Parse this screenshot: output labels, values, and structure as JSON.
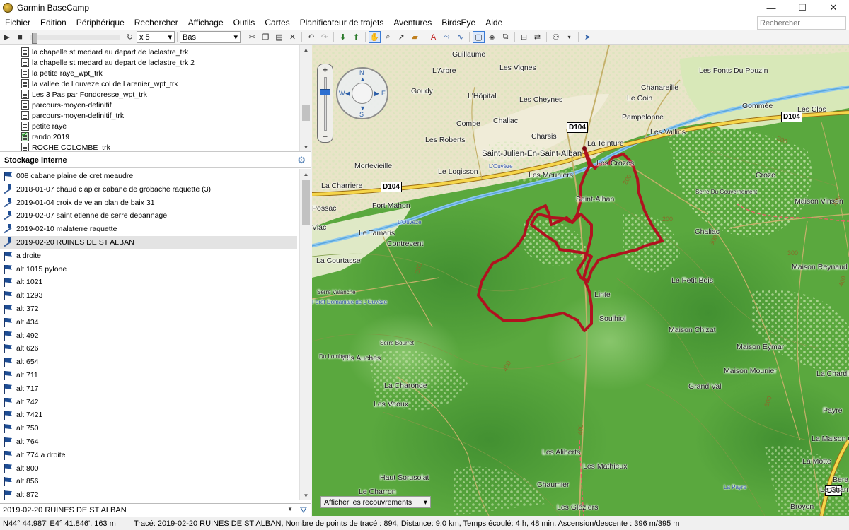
{
  "window": {
    "title": "Garmin BaseCamp",
    "controls": [
      "—",
      "☐",
      "✕"
    ]
  },
  "menu": {
    "items": [
      "Fichier",
      "Edition",
      "Périphérique",
      "Rechercher",
      "Affichage",
      "Outils",
      "Cartes",
      "Planificateur de trajets",
      "Aventures",
      "BirdsEye",
      "Aide"
    ],
    "search_placeholder": "Rechercher"
  },
  "toolbar": {
    "speed": "x 5",
    "speed_arrow": "▾",
    "view": "Bas",
    "view_arrow": "▾"
  },
  "tree": {
    "items": [
      {
        "label": "la chapelle st medard  au depart de laclastre_trk",
        "checked": false
      },
      {
        "label": "la chapelle st medard  au depart de laclastre_trk 2",
        "checked": false
      },
      {
        "label": "la petite raye_wpt_trk",
        "checked": false
      },
      {
        "label": "la vallee de l ouveze  col de l arenier_wpt_trk",
        "checked": false
      },
      {
        "label": "Les 3 Pas par Fondoresse_wpt_trk",
        "checked": false
      },
      {
        "label": "parcours-moyen-definitif",
        "checked": false
      },
      {
        "label": "parcours-moyen-definitif_trk",
        "checked": false
      },
      {
        "label": "petite raye",
        "checked": false
      },
      {
        "label": "rando 2019",
        "checked": true
      },
      {
        "label": "ROCHE COLOMBE_trk",
        "checked": false
      }
    ]
  },
  "storage": {
    "title": "Stockage interne",
    "items": [
      {
        "label": "008  cabane plaine de cret meaudre",
        "icon": "flag-icon"
      },
      {
        "label": "2018-01-07   chaud clapier cabane de grobache   raquette (3)",
        "icon": "track-icon"
      },
      {
        "label": "2019-01-04  croix de velan plan de baix 31",
        "icon": "track-icon"
      },
      {
        "label": "2019-02-07 saint etienne de serre    depannage",
        "icon": "track-icon"
      },
      {
        "label": "2019-02-10  malaterre  raquette",
        "icon": "track-icon"
      },
      {
        "label": "2019-02-20  RUINES DE ST ALBAN",
        "icon": "track-icon",
        "selected": true
      },
      {
        "label": "a droite",
        "icon": "flag-icon"
      },
      {
        "label": "alt 1015 pylone",
        "icon": "flag-icon"
      },
      {
        "label": "alt 1021",
        "icon": "flag-icon"
      },
      {
        "label": "alt 1293",
        "icon": "flag-icon"
      },
      {
        "label": "alt 372",
        "icon": "flag-icon"
      },
      {
        "label": "alt 434",
        "icon": "flag-icon"
      },
      {
        "label": "alt 492",
        "icon": "flag-icon"
      },
      {
        "label": "alt 626",
        "icon": "flag-icon"
      },
      {
        "label": "alt 654",
        "icon": "flag-icon"
      },
      {
        "label": "alt 711",
        "icon": "flag-icon"
      },
      {
        "label": "alt 717",
        "icon": "flag-icon"
      },
      {
        "label": "alt 742",
        "icon": "flag-icon"
      },
      {
        "label": "alt 7421",
        "icon": "flag-icon"
      },
      {
        "label": "alt 750",
        "icon": "flag-icon"
      },
      {
        "label": "alt 764",
        "icon": "flag-icon"
      },
      {
        "label": "alt 774  a droite",
        "icon": "flag-icon"
      },
      {
        "label": "alt 800",
        "icon": "flag-icon"
      },
      {
        "label": "alt 856",
        "icon": "flag-icon"
      },
      {
        "label": "alt 872",
        "icon": "flag-icon"
      }
    ]
  },
  "selection_bar": {
    "value": "2019-02-20  RUINES DE ST ALBAN"
  },
  "map": {
    "overlay_select": "Afficher les recouvrements",
    "compass": {
      "n": "N",
      "s": "S",
      "e": "E",
      "w": "W"
    },
    "track_color": "#b0121f",
    "roads": [
      "D104",
      "D104",
      "D104",
      "D86"
    ],
    "places": [
      "Guillaume",
      "L'Arbre",
      "Les Vignes",
      "Les Fonts Du Pouzin",
      "Goudy",
      "L'Hôpital",
      "Les Cheynes",
      "Chanareille",
      "Le Coin",
      "Gommée",
      "Les Clos",
      "Combe",
      "Chaliac",
      "Pampelonne",
      "Les Roberts",
      "Charsis",
      "La Teinture",
      "Les Vallins",
      "Saint-Julien-En-Saint-Alban",
      "Mortevieille",
      "Le Logisson",
      "Les Meuniers",
      "Les Crozes",
      "Croze",
      "La Charriere",
      "Saint-Alban",
      "Maison Vinson",
      "Fort Mahon",
      "Possac",
      "Le Tamaris",
      "Chaliac",
      "Contrevent",
      "Viac",
      "La Courtasse",
      "Maison Reynaud",
      "Le Petit Bois",
      "Linte",
      "Soulhiol",
      "Maison Chizat",
      "Les Auches",
      "Maison Eymar",
      "Maison Mounier",
      "Grand Val",
      "La Chardina",
      "La Charonde",
      "Les Veoux",
      "Payre",
      "Les Aliberts",
      "Les Mathieux",
      "La Motte",
      "Haut Sorusolat",
      "Chaumier",
      "Bera",
      "Le Charron",
      "Les Gléziers",
      "Broyon",
      "La Maison Cha",
      "Le Charreat",
      "Serre Du Gouvernement",
      "Serre Valanche",
      "Serre Bourret",
      "Du Lombard",
      "Forêt Domaniale de L'Ouvèze",
      "L'Ouvèze",
      "La Payre",
      "L'Ouvèze"
    ],
    "contours": [
      "200",
      "200",
      "300",
      "300",
      "400",
      "400",
      "200",
      "300",
      "400",
      "300",
      "400"
    ]
  },
  "status": {
    "coords": "N44° 44.987' E4° 41.846', 163 m",
    "info": "Tracé: 2019-02-20  RUINES DE ST ALBAN, Nombre de points de tracé : 894, Distance: 9.0 km, Temps écoulé: 4 h, 48 min, Ascension/descente : 396 m/395 m"
  }
}
